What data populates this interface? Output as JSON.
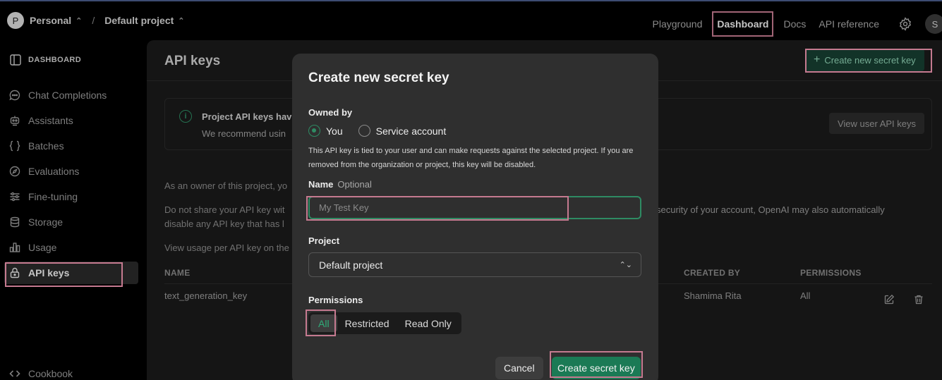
{
  "colors": {
    "accent": "#2e8b63",
    "highlight": "#c57a90",
    "modal_bg": "#2f2f2f"
  },
  "topbar": {
    "org_initial": "P",
    "org_name": "Personal",
    "separator": "/",
    "project_name": "Default project",
    "nav": {
      "playground": "Playground",
      "dashboard": "Dashboard",
      "docs": "Docs",
      "api_reference": "API reference"
    },
    "user_initial": "S"
  },
  "sidebar": {
    "header": "DASHBOARD",
    "items": [
      {
        "label": "Chat Completions",
        "icon": "chat-icon"
      },
      {
        "label": "Assistants",
        "icon": "robot-icon"
      },
      {
        "label": "Batches",
        "icon": "braces-icon"
      },
      {
        "label": "Evaluations",
        "icon": "compass-icon"
      },
      {
        "label": "Fine-tuning",
        "icon": "sliders-icon"
      },
      {
        "label": "Storage",
        "icon": "database-icon"
      },
      {
        "label": "Usage",
        "icon": "bar-chart-icon"
      },
      {
        "label": "API keys",
        "icon": "lock-icon",
        "active": true
      }
    ],
    "footer": {
      "label": "Cookbook",
      "icon": "code-icon"
    }
  },
  "main": {
    "title": "API keys",
    "create_button": "Create new secret key",
    "info_title": "Project API keys hav",
    "info_text": "We recommend usin",
    "view_user_button": "View user API keys",
    "para1": "As an owner of this project, yo",
    "para2a": "Do not share your API key wit",
    "para2a_right": "security of your account, OpenAI may also automatically",
    "para2b": "disable any API key that has l",
    "para3": "View usage per API key on the",
    "table": {
      "headers": {
        "name": "NAME",
        "created_by": "CREATED BY",
        "permissions": "PERMISSIONS"
      },
      "rows": [
        {
          "name": "text_generation_key",
          "created_by": "Shamima Rita",
          "permissions": "All"
        }
      ]
    }
  },
  "modal": {
    "title": "Create new secret key",
    "owned_by_label": "Owned by",
    "owner_options": [
      "You",
      "Service account"
    ],
    "selected_owner": "You",
    "help_text": "This API key is tied to your user and can make requests against the selected project. If you are removed from the organization or project, this key will be disabled.",
    "name_label": "Name",
    "name_optional": "Optional",
    "name_placeholder": "My Test Key",
    "project_label": "Project",
    "project_value": "Default project",
    "permissions_label": "Permissions",
    "permission_options": [
      "All",
      "Restricted",
      "Read Only"
    ],
    "selected_permission": "All",
    "cancel_button": "Cancel",
    "create_button": "Create secret key"
  }
}
